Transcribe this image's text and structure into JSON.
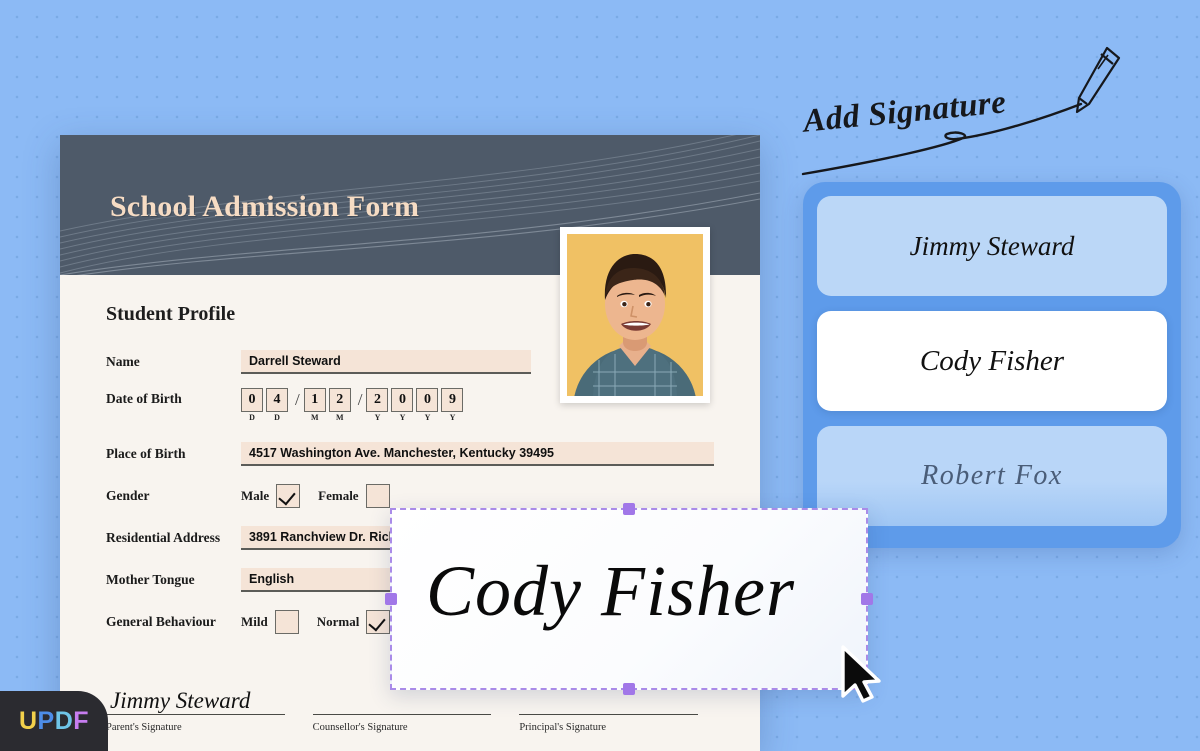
{
  "headline": {
    "text": "Add Signature",
    "pencil_icon": "pencil-icon",
    "underline_icon": "swoosh-underline"
  },
  "document": {
    "title": "School Admission Form",
    "section_title": "Student Profile",
    "fields": {
      "name": {
        "label": "Name",
        "value": "Darrell Steward"
      },
      "dob": {
        "label": "Date of Birth",
        "digits": [
          "0",
          "4",
          "1",
          "2",
          "2",
          "0",
          "0",
          "9"
        ],
        "sublabels": [
          "D",
          "D",
          "M",
          "M",
          "Y",
          "Y",
          "Y",
          "Y"
        ],
        "separator": "/"
      },
      "place_of_birth": {
        "label": "Place of Birth",
        "value": "4517 Washington Ave. Manchester, Kentucky 39495"
      },
      "gender": {
        "label": "Gender",
        "options": [
          {
            "label": "Male",
            "checked": true
          },
          {
            "label": "Female",
            "checked": false
          }
        ]
      },
      "residential_address": {
        "label": "Residential Address",
        "value": "3891 Ranchview Dr. Rich"
      },
      "mother_tongue": {
        "label": "Mother Tongue",
        "value": "English"
      },
      "general_behaviour": {
        "label": "General Behaviour",
        "options": [
          {
            "label": "Mild",
            "checked": false
          },
          {
            "label": "Normal",
            "checked": true
          }
        ]
      }
    },
    "signature_slots": [
      {
        "caption": "Parent's Signature",
        "value": "Jimmy Steward"
      },
      {
        "caption": "Counsellor's Signature",
        "value": ""
      },
      {
        "caption": "Principal's Signature",
        "value": ""
      }
    ]
  },
  "signature_panel": {
    "cards": [
      {
        "name": "Jimmy Steward",
        "state": "available"
      },
      {
        "name": "Cody Fisher",
        "state": "selected"
      },
      {
        "name": "Robert Fox",
        "state": "available"
      }
    ]
  },
  "dragged_signature": {
    "name": "Cody Fisher",
    "handles": [
      "top",
      "right",
      "bottom",
      "left"
    ]
  },
  "branding": {
    "logo_letters": [
      "U",
      "P",
      "D",
      "F"
    ]
  },
  "colors": {
    "background": "#8CBAF5",
    "header": "#4E5A69",
    "title": "#F6DCC4",
    "paper": "#F8F4EF",
    "field_fill": "#F5E4D7",
    "panel": "#5E9BEA",
    "card_light": "#BBD7F7",
    "card_selected": "#FFFFFF",
    "selection": "#A177E8"
  },
  "cursor": {
    "icon": "mouse-pointer-icon"
  }
}
